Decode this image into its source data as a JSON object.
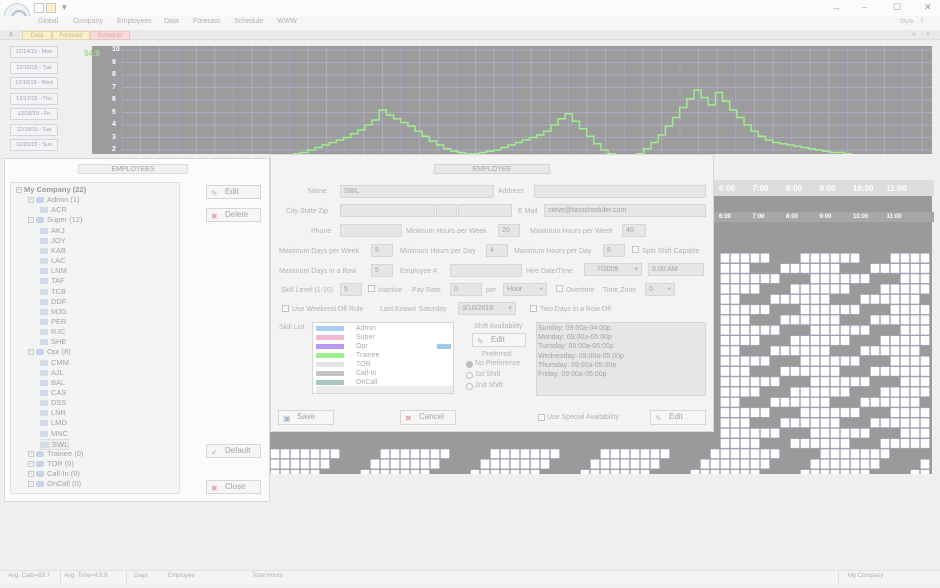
{
  "menu": [
    "Global",
    "Company",
    "Employees",
    "Data",
    "Forecast",
    "Schedule",
    "WWW"
  ],
  "style_label": "Style",
  "tabs": {
    "data": "Data",
    "forecast": "Forecast",
    "schedule": "Schedule"
  },
  "dates": [
    "12/14/15 - Mon",
    "12/15/15 - Tue",
    "12/16/15 - Wed",
    "12/17/15 - Thu",
    "12/18/15 - Fri",
    "12/19/15 - Sat",
    "12/20/15 - Sun"
  ],
  "chart_data": {
    "type": "line",
    "value_label": "$4.9",
    "y_ticks": [
      "10",
      "9",
      "8",
      "7",
      "6",
      "5",
      "4",
      "3",
      "2"
    ],
    "ylim": [
      2,
      10
    ],
    "grid": true,
    "series": [
      {
        "color": "#9df08a",
        "values": [
          1.4,
          1.5,
          1.6,
          1.7,
          1.8,
          2.0,
          2.2,
          2.4,
          2.6,
          2.8,
          3.0,
          3.3,
          3.6,
          4.0,
          4.4,
          5.2,
          4.8,
          4.5,
          4.2,
          3.9,
          3.5,
          3.1,
          2.7,
          2.4,
          2.1,
          1.9,
          1.8,
          1.7,
          1.7,
          1.8,
          1.9,
          2.0,
          2.2,
          2.4,
          2.6,
          2.8,
          3.0,
          3.2,
          3.5,
          4.0,
          4.5,
          4.9,
          4.3,
          3.7,
          3.1,
          2.5,
          2.0,
          1.7,
          1.5,
          1.4,
          1.5,
          1.7,
          2.1,
          2.6,
          3.2,
          3.9,
          4.6,
          5.4,
          6.1,
          6.8,
          6.2,
          5.6,
          6.6,
          5.9,
          5.2,
          4.6,
          4.0,
          3.5,
          3.1,
          2.8,
          2.6,
          2.5,
          2.4,
          2.3,
          2.2,
          2.1,
          2.0,
          1.9,
          1.8,
          1.8,
          1.7,
          1.6,
          1.5,
          1.5,
          1.6,
          1.4,
          1.3,
          1.2,
          1.3,
          1.2,
          1.1,
          1.2,
          1.4
        ]
      }
    ]
  },
  "hours": [
    "6:00",
    "7:00",
    "8:00",
    "9:00",
    "10:00",
    "11:00"
  ],
  "employees_panel": {
    "title": "EMPLOYEES",
    "buttons": {
      "edit": "Edit",
      "delete": "Delete",
      "default": "Default",
      "close": "Close"
    },
    "tree": [
      {
        "level": 0,
        "text": "My Company (22)",
        "bold": true
      },
      {
        "level": 1,
        "text": "Admin (1)"
      },
      {
        "level": 2,
        "text": "ACR"
      },
      {
        "level": 1,
        "text": "Super (12)"
      },
      {
        "level": 2,
        "text": "AKJ"
      },
      {
        "level": 2,
        "text": "JOY"
      },
      {
        "level": 2,
        "text": "KAB"
      },
      {
        "level": 2,
        "text": "LAC"
      },
      {
        "level": 2,
        "text": "LNM"
      },
      {
        "level": 2,
        "text": "TAF"
      },
      {
        "level": 2,
        "text": "TCB"
      },
      {
        "level": 2,
        "text": "DDF"
      },
      {
        "level": 2,
        "text": "MJG"
      },
      {
        "level": 2,
        "text": "PER"
      },
      {
        "level": 2,
        "text": "RJC"
      },
      {
        "level": 2,
        "text": "SHE"
      },
      {
        "level": 1,
        "text": "Opr (8)"
      },
      {
        "level": 2,
        "text": "CMM"
      },
      {
        "level": 2,
        "text": "AJL"
      },
      {
        "level": 2,
        "text": "BAL"
      },
      {
        "level": 2,
        "text": "CAS"
      },
      {
        "level": 2,
        "text": "DSS"
      },
      {
        "level": 2,
        "text": "LNR"
      },
      {
        "level": 2,
        "text": "LMD"
      },
      {
        "level": 2,
        "text": "MNC"
      },
      {
        "level": 2,
        "text": "SWL",
        "selected": true
      },
      {
        "level": 1,
        "text": "Trainee (0)"
      },
      {
        "level": 1,
        "text": "TOR (0)"
      },
      {
        "level": 1,
        "text": "Call-In (0)"
      },
      {
        "level": 1,
        "text": "OnCall (0)"
      }
    ]
  },
  "employee_dialog": {
    "title": "EMPLOYEE",
    "name_label": "Name",
    "name_value": "SWL",
    "address_label": "Address",
    "csz_label": "City State Zip",
    "email_label": "E Mail",
    "email_value": "steve@tasscheduler.com",
    "phone_label": "Phone",
    "min_hours_week_label": "Minimum Hours per Week",
    "min_hours_week_value": "20",
    "max_hours_week_label": "Maximum Hours per Week",
    "max_hours_week_value": "40",
    "max_days_week_label": "Maximum Days per Week",
    "max_days_week_value": "5",
    "min_hours_day_label": "Minimum Hours per Day",
    "min_hours_day_value": "4",
    "max_hours_day_label": "Maximum Hours per Day",
    "max_hours_day_value": "8",
    "split_shift_label": "Split Shift Capable",
    "max_days_row_label": "Maximum Days in a Row",
    "max_days_row_value": "5",
    "employee_num_label": "Employee #",
    "hire_label": "Hire Date/Time",
    "hire_date": "7/2009",
    "hire_time": "8:00 AM",
    "skill_level_label": "Skill Level (1-10)",
    "skill_level_value": "5",
    "inactive_label": "Inactive",
    "pay_rate_label": "Pay Rate",
    "pay_rate_value": "0",
    "per_label": "per",
    "per_value": "Hour",
    "overtime_label": "Overtime",
    "timezone_label": "Time Zone",
    "timezone_value": "0",
    "weekend_off_label": "Use Weekend Off Rule",
    "last_saturday_label": "Last Known Saturday",
    "last_saturday_value": "3/10/2018",
    "two_days_label": "Two Days in a Row Off",
    "skill_list_label": "Skill List",
    "skills": [
      {
        "name": "Admin",
        "color": "#a9cdef"
      },
      {
        "name": "Super",
        "color": "#f1b8d6"
      },
      {
        "name": "Opr",
        "color": "#b998f0"
      },
      {
        "name": "Trainee",
        "color": "#9cef8e"
      },
      {
        "name": "TOR",
        "color": "#e3e3e3"
      },
      {
        "name": "Call-In",
        "color": "#c5c5c5"
      },
      {
        "name": "OnCall",
        "color": "#a9c6c3"
      }
    ],
    "skill_marker_color": "#9fc8ef",
    "shift_avail_label": "Shift Availability",
    "shift_edit": "Edit",
    "preferred_label": "Preferred",
    "pref_options": [
      "No Preference",
      "1st Shift",
      "2nd Shift"
    ],
    "availability": [
      "Sunday: 09:00a-04:00p",
      "Monday: 09:00a-05:00p",
      "Tuesday: 09:00a-05:00p",
      "Wednesday: 09:00a-05:00p",
      "Thursday: 09:00a-05:00p",
      "Friday: 09:00a-05:00p"
    ],
    "save": "Save",
    "cancel": "Cancel",
    "use_special_label": "Use Special Availability",
    "edit": "Edit"
  },
  "status": {
    "calls": "Avg. Calls=83.7",
    "time": "Avg. Time=4:9.8",
    "days": "Days",
    "employee": "Employee",
    "total_hours": "Total Hours",
    "company": "My Company"
  }
}
